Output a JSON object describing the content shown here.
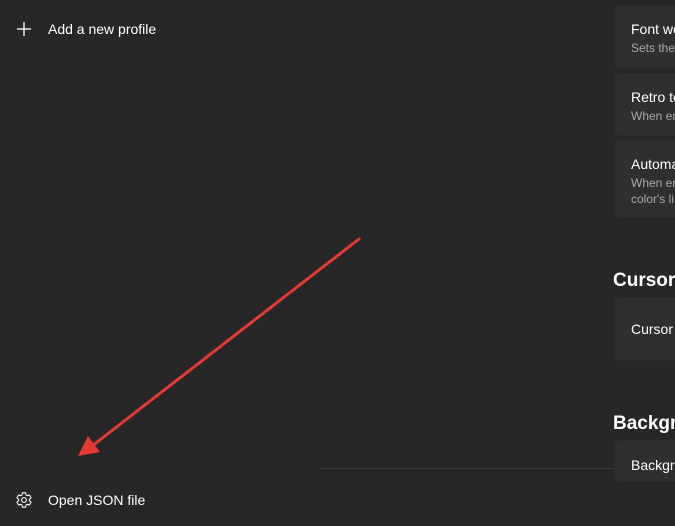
{
  "sidebar": {
    "add_profile_label": "Add a new profile",
    "add_profile_icon": "plus-icon",
    "open_json_label": "Open JSON file",
    "open_json_icon": "gear-icon"
  },
  "settings": {
    "cards_top": [
      {
        "title": "Font we",
        "description": [
          "Sets the"
        ]
      },
      {
        "title": "Retro te",
        "description": [
          "When er"
        ]
      },
      {
        "title": "Automa",
        "description": [
          "When er",
          "color's li"
        ]
      }
    ],
    "cursor_section": {
      "header": "Cursor",
      "card_title": "Cursor"
    },
    "background_section": {
      "header": "Backgr",
      "card_title": "Backgro"
    }
  },
  "colors": {
    "background": "#272727",
    "card": "#2f2f2f",
    "annotation_arrow": "#e53935"
  }
}
